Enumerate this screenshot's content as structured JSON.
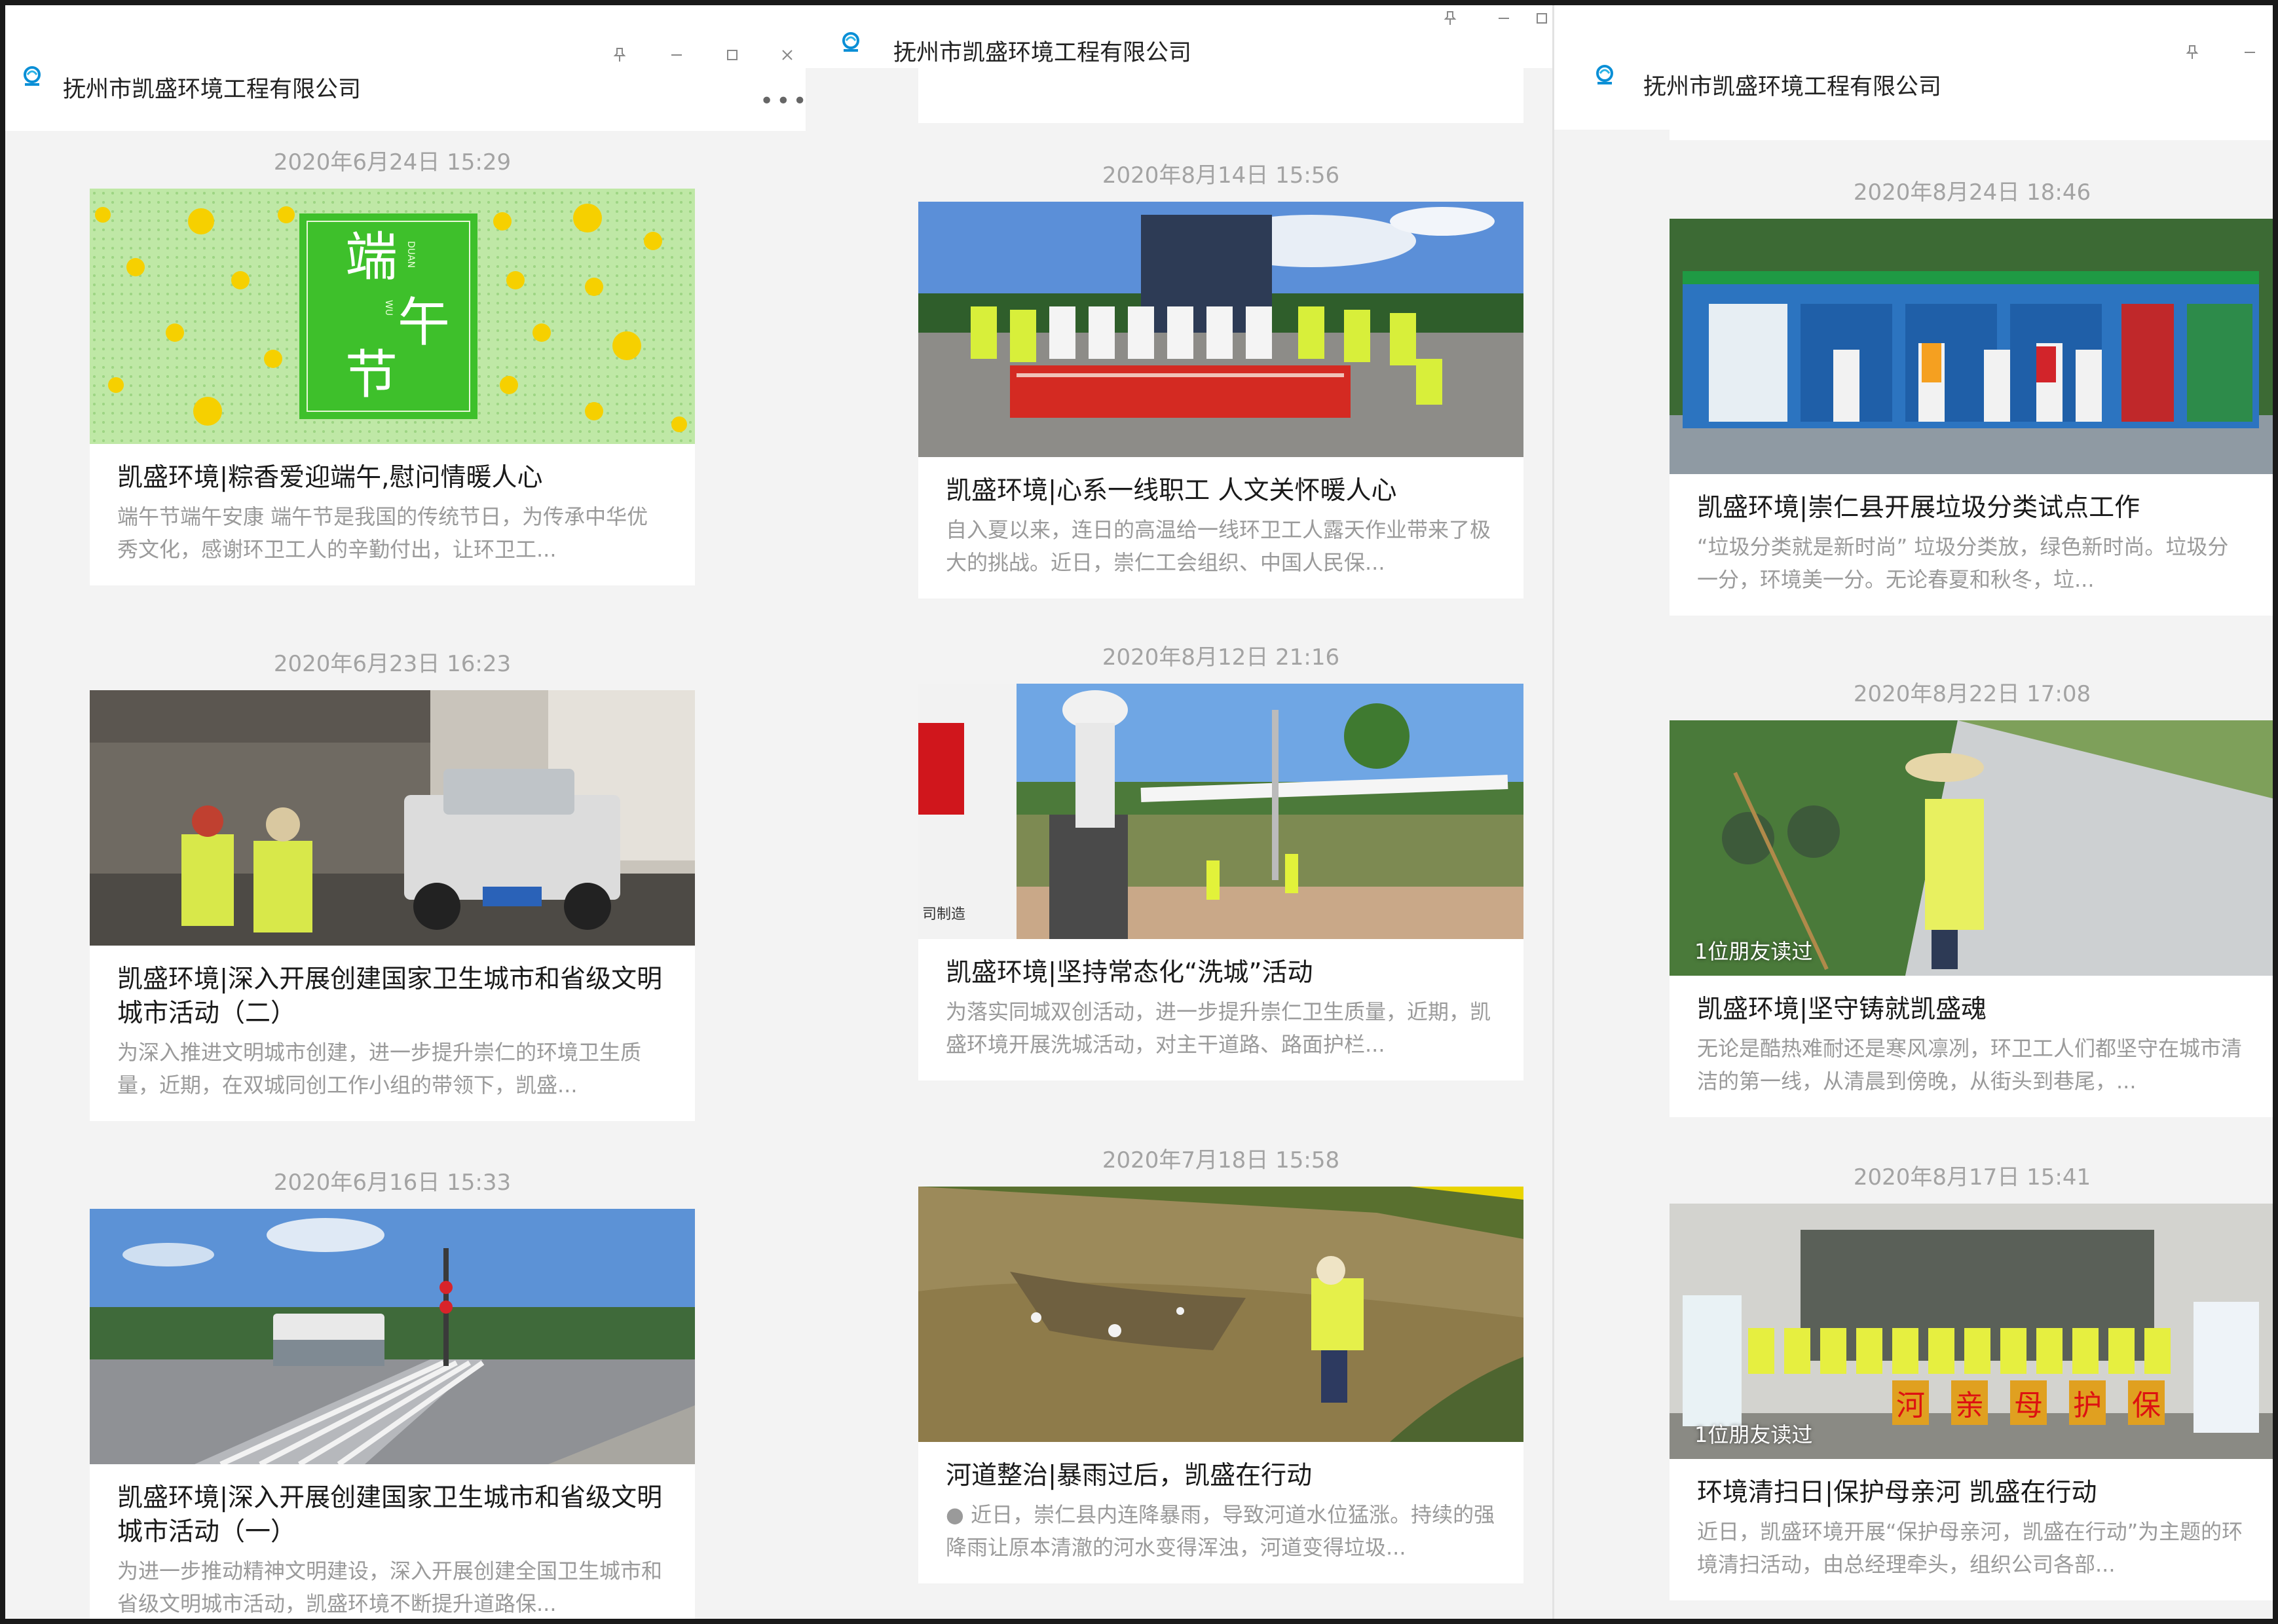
{
  "app": {
    "title_left": "抚州市凯盛环境工程有限公司",
    "title_middle": "抚州市凯盛环境工程有限公司",
    "title_right": "抚州市凯盛环境工程有限公司",
    "more_label": "•••",
    "colors": {
      "accent": "#0a8fd6",
      "read_badge": "#ffffff"
    }
  },
  "windows": [
    {
      "name": "left",
      "articles": [
        {
          "time": "2020年6月24日 15:29",
          "title": "凯盛环境|粽香爱迎端午,慰问情暖人心",
          "desc": "端午节端午安康      端午节是我国的传统节日，为传承中华优秀文化，感谢环卫工人的辛勤付出，让环卫工...",
          "image": "端午节-banner",
          "banner_text": {
            "cn1": "端",
            "cn2": "午",
            "cn3": "节",
            "pin1": "DUAN",
            "pin2": "WU"
          }
        },
        {
          "time": "2020年6月23日 16:23",
          "title": "凯盛环境|深入开展创建国家卫生城市和省级文明城市活动（二）",
          "desc": "为深入推进文明城市创建，进一步提升崇仁的环境卫生质量，近期，在双城同创工作小组的带领下，凯盛...",
          "image": "workers-with-truck-photo"
        },
        {
          "time": "2020年6月16日 15:33",
          "title": "凯盛环境|深入开展创建国家卫生城市和省级文明城市活动（一）",
          "desc": "为进一步推动精神文明建设，深入开展创建全国卫生城市和省级文明城市活动，凯盛环境不断提升道路保...",
          "image": "road-sweeper-truck-photo"
        }
      ]
    },
    {
      "name": "middle",
      "articles": [
        {
          "time": "2020年8月14日 15:56",
          "title": "凯盛环境|心系一线职工 人文关怀暖人心",
          "desc": "自入夏以来，连日的高温给一线环卫工人露天作业带来了极大的挑战。近日，崇仁工会组织、中国人民保...",
          "image": "group-photo-banner"
        },
        {
          "time": "2020年8月12日 21:16",
          "title": "凯盛环境|坚持常态化“洗城”活动",
          "desc": "为落实同城双创活动，进一步提升崇仁卫生质量，近期，凯盛环境开展洗城活动，对主干道路、路面护栏...",
          "image": "street-washing-photo",
          "truck_text": "司制造"
        },
        {
          "time": "2020年7月18日 15:58",
          "title": "河道整治|暴雨过后，凯盛在行动",
          "desc": "● 近日，崇仁县内连降暴雨，导致河道水位猛涨。持续的强降雨让原本清澈的河水变得浑浊，河道变得垃圾...",
          "image": "river-cleaning-photo"
        }
      ]
    },
    {
      "name": "right",
      "articles": [
        {
          "time": "2020年8月24日 18:46",
          "title": "凯盛环境|崇仁县开展垃圾分类试点工作",
          "desc": "“垃圾分类就是新时尚”        垃圾分类放，绿色新时尚。垃圾分一分，环境美一分。无论春夏和秋冬，垃...",
          "image": "recycling-station-photo"
        },
        {
          "time": "2020年8月22日 17:08",
          "title": "凯盛环境|坚守铸就凯盛魂",
          "desc": "无论是酷热难耐还是寒风凛冽，环卫工人们都坚守在城市清洁的第一线，从清晨到傍晚，从街头到巷尾，...",
          "image": "roadside-worker-photo",
          "read_badge": "1位朋友读过"
        },
        {
          "time": "2020年8月17日 15:41",
          "title": "环境清扫日|保护母亲河 凯盛在行动",
          "desc": "近日，凯盛环境开展“保护母亲河，凯盛在行动”为主题的环境清扫活动，由总经理牵头，组织公司各部...",
          "image": "group-banner-photo",
          "read_badge": "1位朋友读过",
          "banner_chars": [
            "河",
            "亲",
            "母",
            "护",
            "保"
          ]
        }
      ]
    }
  ]
}
